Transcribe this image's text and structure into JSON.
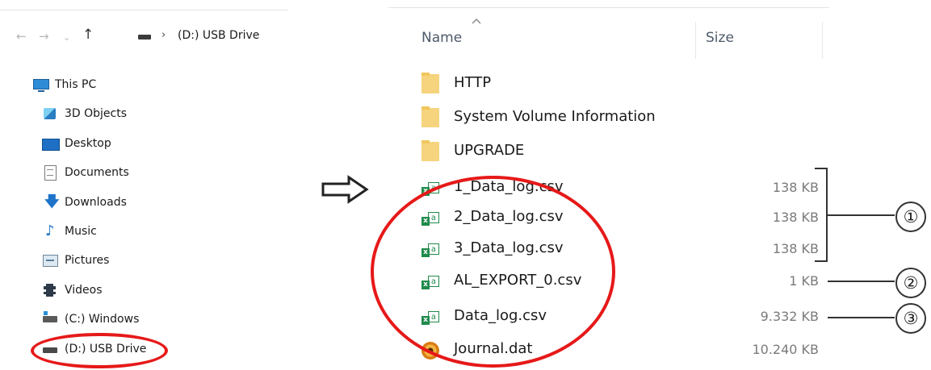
{
  "address_bar": {
    "back_glyph": "←",
    "forward_glyph": "→",
    "recent_glyph": "⌄",
    "up_glyph": "↑",
    "separator": "›",
    "path": "(D:) USB Drive"
  },
  "nav_tree": {
    "items": [
      {
        "label": "This PC",
        "icon": "computer-icon"
      },
      {
        "label": "3D Objects",
        "icon": "3d-objects-icon"
      },
      {
        "label": "Desktop",
        "icon": "desktop-icon"
      },
      {
        "label": "Documents",
        "icon": "documents-icon"
      },
      {
        "label": "Downloads",
        "icon": "download-arrow-icon"
      },
      {
        "label": "Music",
        "icon": "music-note-icon"
      },
      {
        "label": "Pictures",
        "icon": "pictures-icon"
      },
      {
        "label": "Videos",
        "icon": "film-icon"
      },
      {
        "label": "(C:) Windows",
        "icon": "windows-drive-icon"
      },
      {
        "label": "(D:) USB Drive",
        "icon": "usb-drive-icon"
      }
    ]
  },
  "file_list": {
    "columns": {
      "name": "Name",
      "size": "Size"
    },
    "files": [
      {
        "name": "HTTP",
        "size": "",
        "type": "folder"
      },
      {
        "name": "System Volume Information",
        "size": "",
        "type": "folder"
      },
      {
        "name": "UPGRADE",
        "size": "",
        "type": "folder"
      },
      {
        "name": "1_Data_log.csv",
        "size": "138 KB",
        "type": "csv"
      },
      {
        "name": "2_Data_log.csv",
        "size": "138 KB",
        "type": "csv"
      },
      {
        "name": "3_Data_log.csv",
        "size": "138 KB",
        "type": "csv"
      },
      {
        "name": "AL_EXPORT_0.csv",
        "size": "1 KB",
        "type": "csv"
      },
      {
        "name": "Data_log.csv",
        "size": "9.332 KB",
        "type": "csv"
      },
      {
        "name": "Journal.dat",
        "size": "10.240 KB",
        "type": "dat"
      }
    ]
  },
  "annotations": {
    "markers": [
      "①",
      "②",
      "③"
    ],
    "highlight_color": "#e61919"
  }
}
